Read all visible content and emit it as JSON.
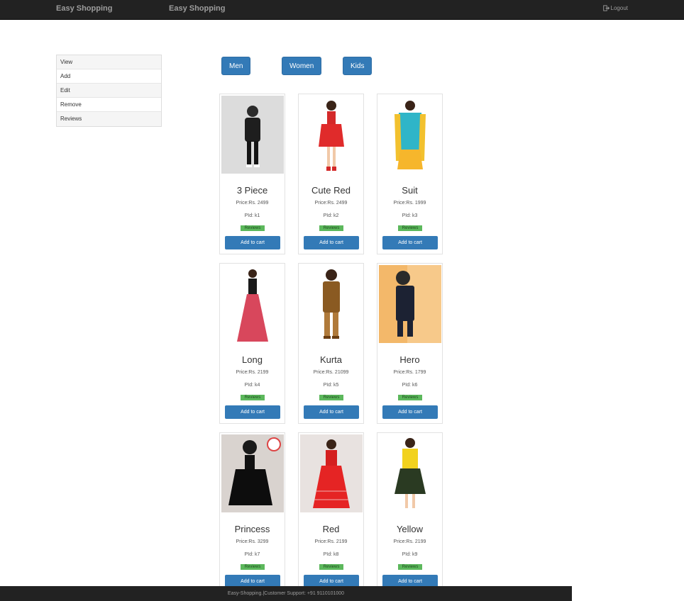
{
  "navbar": {
    "brand_left": "Easy Shopping",
    "brand_center": "Easy Shopping",
    "logout": "Logout",
    "logout_icon": "logout-icon"
  },
  "sidebar": {
    "items": [
      {
        "label": "View"
      },
      {
        "label": "Add"
      },
      {
        "label": "Edit"
      },
      {
        "label": "Remove"
      },
      {
        "label": "Reviews"
      }
    ]
  },
  "categories": [
    {
      "label": "Men"
    },
    {
      "label": "Women"
    },
    {
      "label": "Kids"
    }
  ],
  "products": [
    {
      "name": "3 Piece",
      "price": "Price:Rs. 2499",
      "pid": "PId: k1",
      "reviews": "Reviews",
      "add": "Add to cart"
    },
    {
      "name": "Cute Red",
      "price": "Price:Rs. 2499",
      "pid": "PId: k2",
      "reviews": "Reviews",
      "add": "Add to cart"
    },
    {
      "name": "Suit",
      "price": "Price:Rs. 1999",
      "pid": "PId: k3",
      "reviews": "Reviews",
      "add": "Add to cart"
    },
    {
      "name": "Long",
      "price": "Price:Rs. 2199",
      "pid": "PId: k4",
      "reviews": "Reviews",
      "add": "Add to cart"
    },
    {
      "name": "Kurta",
      "price": "Price:Rs. 21099",
      "pid": "PId: k5",
      "reviews": "Reviews",
      "add": "Add to cart"
    },
    {
      "name": "Hero",
      "price": "Price:Rs. 1799",
      "pid": "PId: k6",
      "reviews": "Reviews",
      "add": "Add to cart"
    },
    {
      "name": "Princess",
      "price": "Price:Rs. 3299",
      "pid": "PId: k7",
      "reviews": "Reviews",
      "add": "Add to cart"
    },
    {
      "name": "Red",
      "price": "Price:Rs. 2199",
      "pid": "PId: k8",
      "reviews": "Reviews",
      "add": "Add to cart"
    },
    {
      "name": "Yellow",
      "price": "Price:Rs. 2199",
      "pid": "PId: k9",
      "reviews": "Reviews",
      "add": "Add to cart"
    }
  ],
  "footer": {
    "text": "Easy-Shopping.|Customer Support: +91 9110101000"
  },
  "colors": {
    "navbar_bg": "#222222",
    "primary": "#337ab7",
    "review_badge": "#5cb85c"
  }
}
